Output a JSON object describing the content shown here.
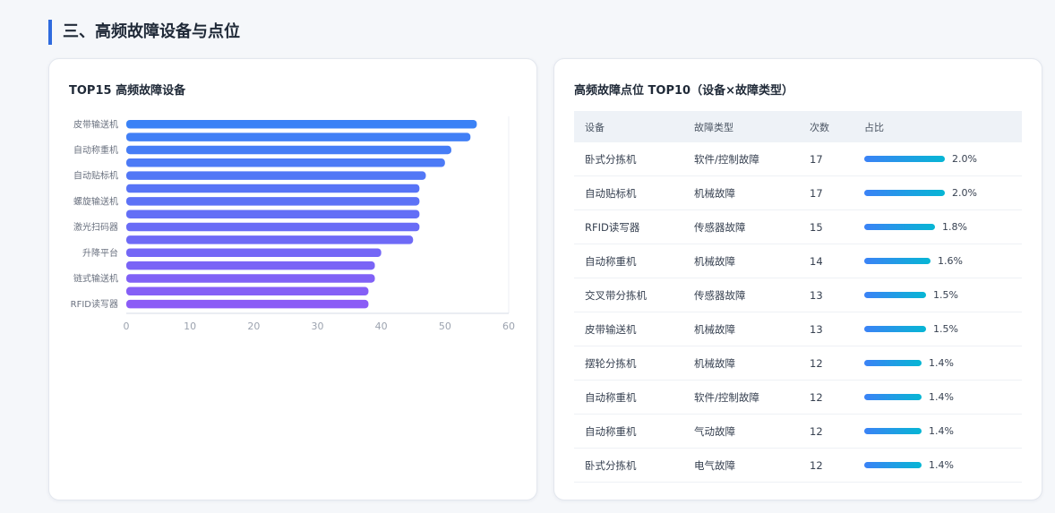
{
  "section": {
    "title": "三、高频故障设备与点位"
  },
  "left_card": {
    "title": "TOP15 高频故障设备"
  },
  "chart_data": {
    "type": "bar",
    "orientation": "horizontal",
    "categories": [
      "皮带输送机",
      "",
      "自动称重机",
      "",
      "自动贴标机",
      "",
      "螺旋输送机",
      "",
      "激光扫码器",
      "",
      "升降平台",
      "",
      "链式输送机",
      "",
      "RFID读写器"
    ],
    "values": [
      55,
      54,
      51,
      50,
      47,
      46,
      46,
      46,
      46,
      45,
      40,
      39,
      39,
      38,
      38
    ],
    "xticks": [
      0,
      10,
      20,
      30,
      40,
      50,
      60
    ],
    "xlim": [
      0,
      60
    ],
    "colors": {
      "start": "#3b82f6",
      "end": "#8b5cf6"
    },
    "grid": true
  },
  "right_card": {
    "title": "高频故障点位 TOP10（设备×故障类型）",
    "columns": [
      "设备",
      "故障类型",
      "次数",
      "占比"
    ],
    "max_count": 17,
    "rows": [
      {
        "device": "卧式分拣机",
        "type": "软件/控制故障",
        "count": "17",
        "pct": "2.0%",
        "value": 17
      },
      {
        "device": "自动贴标机",
        "type": "机械故障",
        "count": "17",
        "pct": "2.0%",
        "value": 17
      },
      {
        "device": "RFID读写器",
        "type": "传感器故障",
        "count": "15",
        "pct": "1.8%",
        "value": 15
      },
      {
        "device": "自动称重机",
        "type": "机械故障",
        "count": "14",
        "pct": "1.6%",
        "value": 14
      },
      {
        "device": "交叉带分拣机",
        "type": "传感器故障",
        "count": "13",
        "pct": "1.5%",
        "value": 13
      },
      {
        "device": "皮带输送机",
        "type": "机械故障",
        "count": "13",
        "pct": "1.5%",
        "value": 13
      },
      {
        "device": "摆轮分拣机",
        "type": "机械故障",
        "count": "12",
        "pct": "1.4%",
        "value": 12
      },
      {
        "device": "自动称重机",
        "type": "软件/控制故障",
        "count": "12",
        "pct": "1.4%",
        "value": 12
      },
      {
        "device": "自动称重机",
        "type": "气动故障",
        "count": "12",
        "pct": "1.4%",
        "value": 12
      },
      {
        "device": "卧式分拣机",
        "type": "电气故障",
        "count": "12",
        "pct": "1.4%",
        "value": 12
      }
    ]
  }
}
